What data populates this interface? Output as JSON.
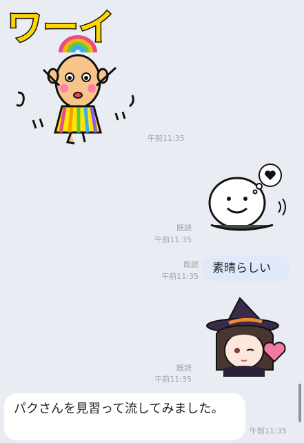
{
  "messages": [
    {
      "kind": "sticker",
      "side": "left",
      "sticker_text": "ワーイ",
      "time": "午前11:35"
    },
    {
      "kind": "sticker",
      "side": "right",
      "read": "既読",
      "time": "午前11:35"
    },
    {
      "kind": "text",
      "side": "right",
      "text": "素晴らしい",
      "read": "既読",
      "time": "午前11:35"
    },
    {
      "kind": "sticker",
      "side": "right",
      "read": "既読",
      "time": "午前11:35"
    },
    {
      "kind": "text",
      "side": "left",
      "text": "パクさんを見習って流してみました。",
      "time": "午前11:35"
    }
  ],
  "colors": {
    "background": "#e9edf3",
    "outgoing_bubble": "#dfe9f9",
    "incoming_bubble": "#ffffff",
    "timestamp": "#9aa1ab"
  }
}
